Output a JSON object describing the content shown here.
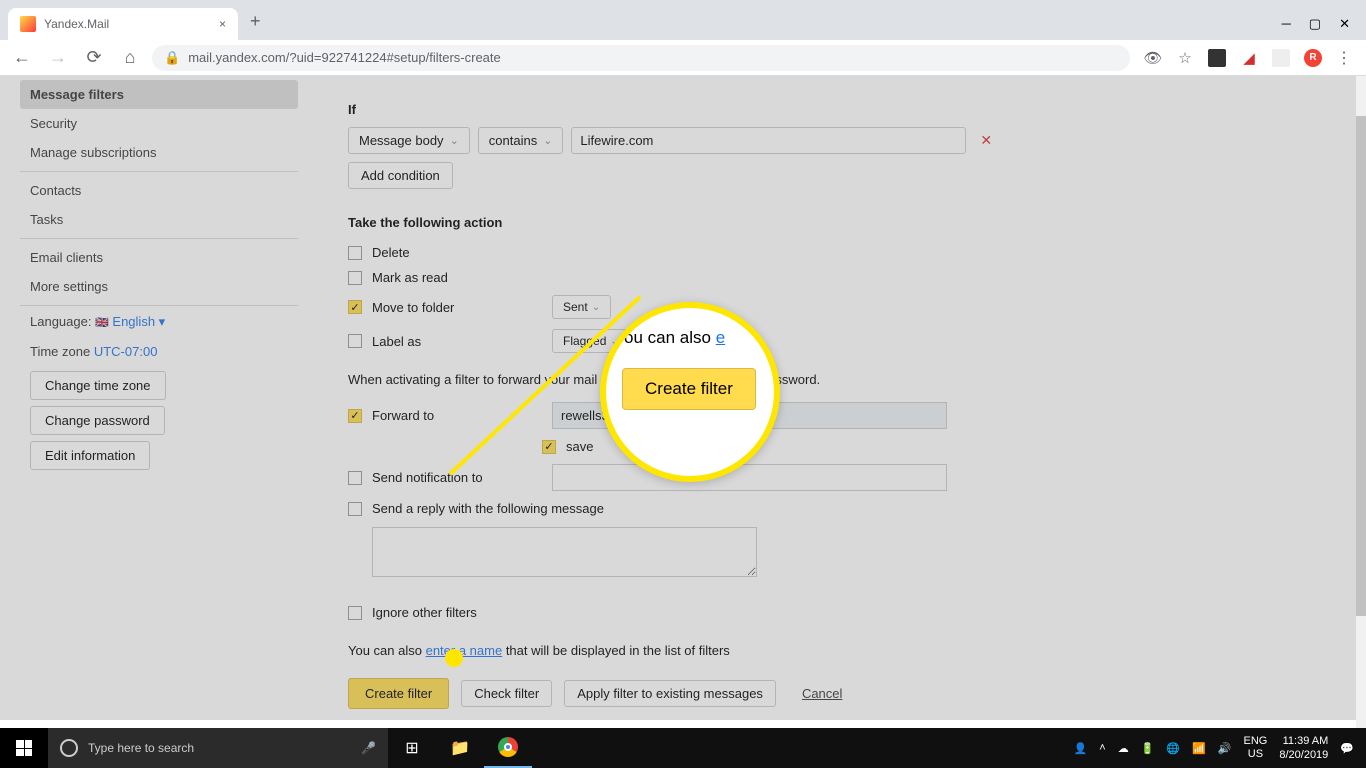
{
  "browser": {
    "tab_title": "Yandex.Mail",
    "url": "mail.yandex.com/?uid=922741224#setup/filters-create"
  },
  "sidebar": {
    "items": [
      "Message filters",
      "Security",
      "Manage subscriptions"
    ],
    "items2": [
      "Contacts",
      "Tasks"
    ],
    "items3": [
      "Email clients",
      "More settings"
    ],
    "lang_label": "Language:",
    "lang_value": "English",
    "tz_label": "Time zone",
    "tz_value": "UTC-07:00",
    "btn_tz": "Change time zone",
    "btn_pw": "Change password",
    "btn_edit": "Edit information"
  },
  "filter": {
    "if_label": "If",
    "cond_field": "Message body",
    "cond_op": "contains",
    "cond_value": "Lifewire.com",
    "add_cond": "Add condition",
    "action_label": "Take the following action",
    "delete": "Delete",
    "mark_read": "Mark as read",
    "move_folder": "Move to folder",
    "move_target": "Sent",
    "label_as": "Label as",
    "label_target": "Flagged",
    "forward_note": "When activating a filter to forward your mail",
    "forward_note2": "password.",
    "forward_to": "Forward to",
    "forward_value": "rewells3",
    "save_copy": "save",
    "send_notif": "Send notification to",
    "send_reply": "Send a reply with the following message",
    "ignore": "Ignore other filters",
    "also_pre": "You can also ",
    "also_link": "enter a name",
    "also_post": " that will be displayed in the list of filters",
    "btn_create": "Create filter",
    "btn_check": "Check filter",
    "btn_apply": "Apply filter to existing messages",
    "cancel": "Cancel"
  },
  "zoom": {
    "text1": "ou can also ",
    "link": "e",
    "btn": "Create filter"
  },
  "taskbar": {
    "search": "Type here to search",
    "lang1": "ENG",
    "lang2": "US",
    "time": "11:39 AM",
    "date": "8/20/2019"
  }
}
